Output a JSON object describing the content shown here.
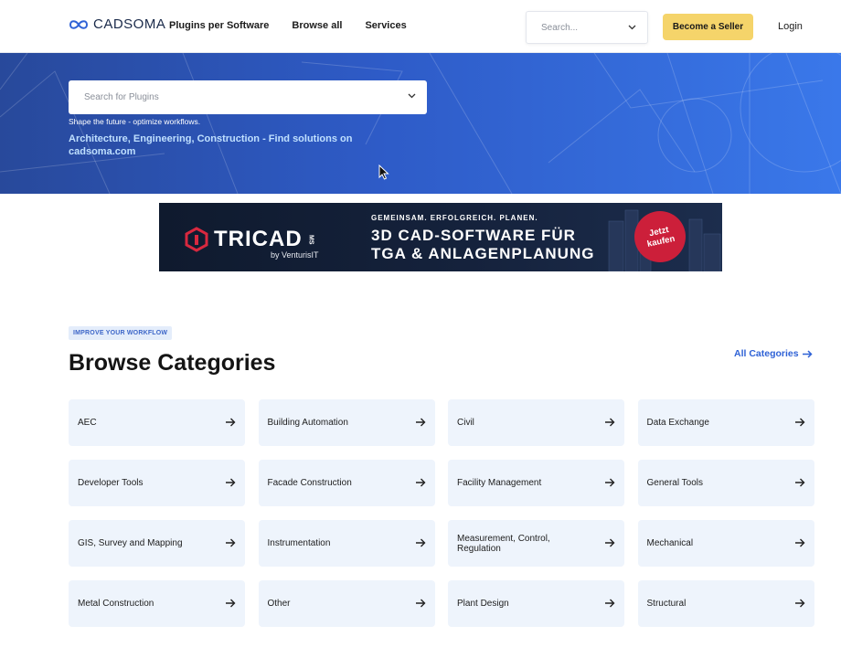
{
  "header": {
    "logo_text": "CADSOMA",
    "nav": [
      "Plugins per Software",
      "Browse all",
      "Services"
    ],
    "search_placeholder": "Search...",
    "seller_button": "Become a Seller",
    "login": "Login"
  },
  "hero": {
    "search_placeholder": "Search for Plugins",
    "tagline": "Shape the future - optimize workflows.",
    "headline": "Architecture, Engineering, Construction - Find solutions on cadsoma.com"
  },
  "banner": {
    "brand": "TRICAD",
    "brand_suffix": "MS",
    "by_line": "by VenturisIT",
    "tagline": "GEMEINSAM. ERFOLGREICH. PLANEN.",
    "headline_1": "3D CAD-SOFTWARE FÜR",
    "headline_2": "TGA & ANLAGENPLANUNG",
    "badge_1": "Jetzt",
    "badge_2": "kaufen"
  },
  "categories": {
    "eyebrow": "IMPROVE YOUR WORKFLOW",
    "title": "Browse Categories",
    "all_link": "All Categories",
    "items": [
      "AEC",
      "Building Automation",
      "Civil",
      "Data Exchange",
      "Developer Tools",
      "Facade Construction",
      "Facility Management",
      "General Tools",
      "GIS, Survey and Mapping",
      "Instrumentation",
      "Measurement, Control, Regulation",
      "Mechanical",
      "Metal Construction",
      "Other",
      "Plant Design",
      "Structural"
    ]
  },
  "colors": {
    "accent": "#2f62d6",
    "seller_button": "#f5d46a",
    "card_bg": "#eef4fc",
    "hero_start": "#28499b",
    "hero_end": "#3a78ea"
  }
}
